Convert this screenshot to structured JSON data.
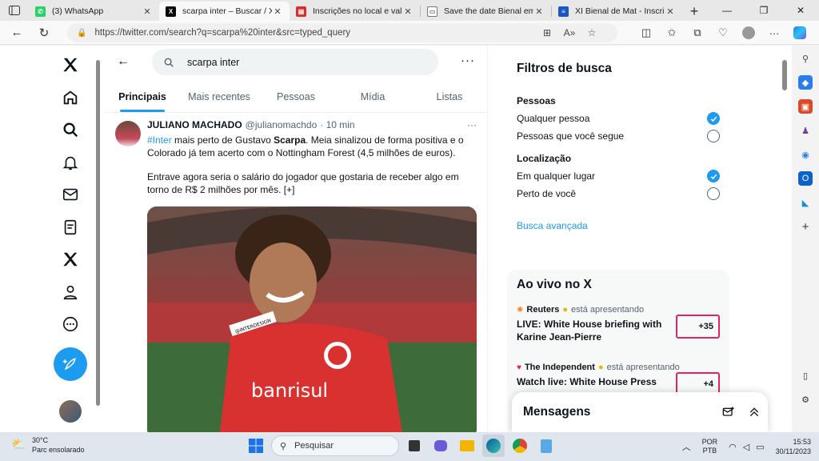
{
  "browser": {
    "tabs": [
      {
        "title": "(3) WhatsApp",
        "fav_color": "#25d366",
        "fav_icon": "whatsapp-icon"
      },
      {
        "title": "scarpa inter – Buscar / X",
        "fav_color": "#000000",
        "fav_icon": "x-icon",
        "active": true
      },
      {
        "title": "Inscrições no local e valores",
        "fav_color": "#d32f2f",
        "fav_icon": "pdf-icon"
      },
      {
        "title": "Save the date Bienal em Sã...",
        "fav_color": "#777777",
        "fav_icon": "doc-icon"
      },
      {
        "title": "XI Bienal de Mat - Inscriçõ...",
        "fav_color": "#1a56c4",
        "fav_icon": "form-icon"
      }
    ],
    "url": "https://twitter.com/search?q=scarpa%20inter&src=typed_query"
  },
  "search": {
    "query": "scarpa inter"
  },
  "tabs": [
    {
      "label": "Principais",
      "active": true
    },
    {
      "label": "Mais recentes"
    },
    {
      "label": "Pessoas"
    },
    {
      "label": "Mídia"
    },
    {
      "label": "Listas"
    }
  ],
  "tweet": {
    "name": "JULIANO MACHADO",
    "handle": "@julianomachdo",
    "time": "· 10 min",
    "hashtag": "#Inter",
    "text_a": " mais perto de Gustavo ",
    "bold": "Scarpa",
    "text_b": ". Meia sinalizou de forma positiva e o Colorado já tem acerto com o Nottingham Forest (4,5 milhões de euros).",
    "text_c": "Entrave agora seria o salário do jogador que gostaria de receber algo em torno de R$ 2 milhões por mês. [+]",
    "image_tag": "@INTERDESIGN",
    "sponsor": "banrisul"
  },
  "filters": {
    "title": "Filtros de busca",
    "people_label": "Pessoas",
    "people_any": "Qualquer pessoa",
    "people_follow": "Pessoas que você segue",
    "location_label": "Localização",
    "location_any": "Em qualquer lugar",
    "location_near": "Perto de você",
    "advanced": "Busca avançada"
  },
  "live": {
    "title": "Ao vivo no X",
    "items": [
      {
        "source": "Reuters",
        "presenting": "está apresentando",
        "title": "LIVE: White House briefing with Karine Jean-Pierre",
        "count": "+35"
      },
      {
        "source": "The Independent",
        "presenting": "está apresentando",
        "title": "Watch live: White House Press",
        "count": "+4"
      }
    ]
  },
  "messages": {
    "title": "Mensagens"
  },
  "taskbar": {
    "temp": "30°C",
    "weather": "Parc ensolarado",
    "search_placeholder": "Pesquisar",
    "lang_1": "POR",
    "lang_2": "PTB",
    "time": "15:53",
    "date": "30/11/2023"
  },
  "colors": {
    "accent": "#1d9bf0",
    "live_border": "#e0245e"
  }
}
